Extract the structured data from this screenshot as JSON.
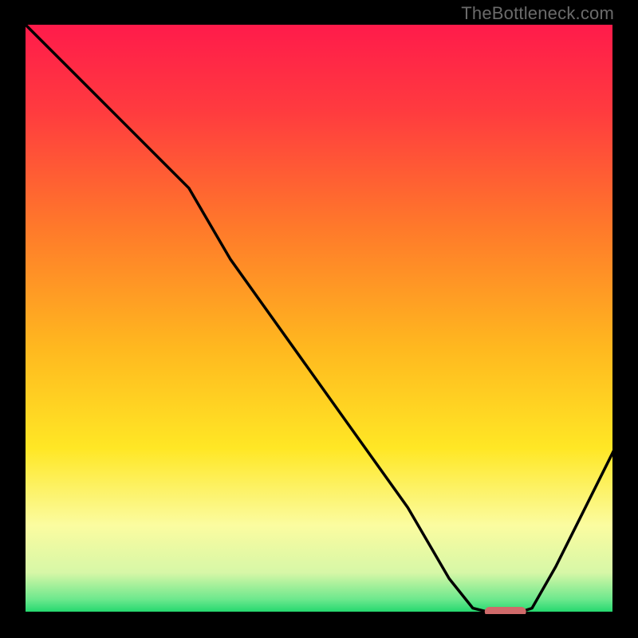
{
  "watermark": "TheBottleneck.com",
  "chart_data": {
    "type": "line",
    "title": "",
    "xlabel": "",
    "ylabel": "",
    "xlim": [
      0,
      100
    ],
    "ylim": [
      0,
      100
    ],
    "grid": false,
    "legend": false,
    "series": [
      {
        "name": "bottleneck-curve",
        "x": [
          0,
          8,
          16,
          24,
          28,
          35,
          45,
          55,
          65,
          72,
          76,
          80,
          83,
          86,
          90,
          94,
          100
        ],
        "y": [
          100,
          92,
          84,
          76,
          72,
          60,
          46,
          32,
          18,
          6,
          1,
          0,
          0,
          1,
          8,
          16,
          28
        ]
      }
    ],
    "marker": {
      "name": "optimal-range",
      "x_start": 78,
      "x_end": 85,
      "y": 0.4,
      "color": "#cf6a6a"
    },
    "gradient_stops": [
      {
        "offset": 0.0,
        "color": "#ff1a4b"
      },
      {
        "offset": 0.15,
        "color": "#ff3b3f"
      },
      {
        "offset": 0.35,
        "color": "#ff7a2a"
      },
      {
        "offset": 0.55,
        "color": "#ffb81f"
      },
      {
        "offset": 0.72,
        "color": "#ffe725"
      },
      {
        "offset": 0.85,
        "color": "#fbfca0"
      },
      {
        "offset": 0.93,
        "color": "#d7f7a7"
      },
      {
        "offset": 0.975,
        "color": "#6de88d"
      },
      {
        "offset": 1.0,
        "color": "#18d66a"
      }
    ]
  }
}
